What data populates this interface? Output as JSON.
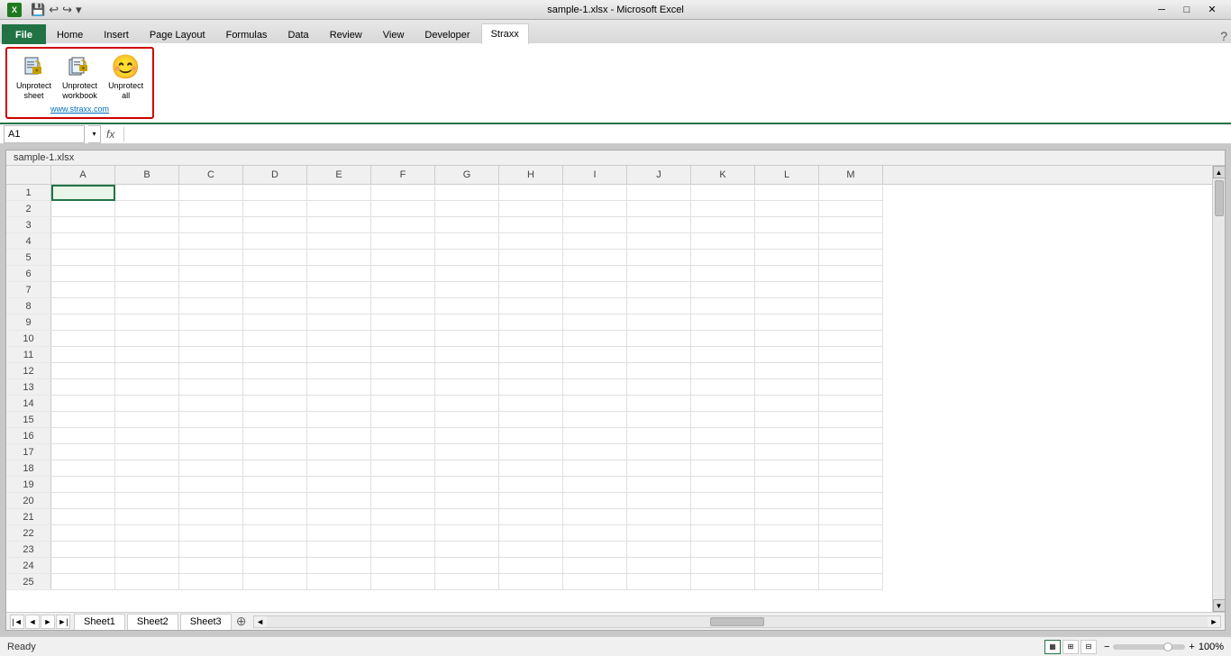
{
  "titlebar": {
    "title": "sample-1.xlsx  -  Microsoft Excel",
    "quicksave": "💾",
    "undo": "↩",
    "redo": "↪",
    "customize": "▾"
  },
  "ribbon": {
    "tabs": [
      "File",
      "Home",
      "Insert",
      "Page Layout",
      "Formulas",
      "Data",
      "Review",
      "View",
      "Developer",
      "Straxx"
    ],
    "active_tab": "Straxx",
    "groups": {
      "straxx": {
        "buttons": [
          {
            "label": "Unprotect\nsheet",
            "icon": "unlock-sheet"
          },
          {
            "label": "Unprotect\nworkbook",
            "icon": "unlock-workbook"
          },
          {
            "label": "Unprotect\nall",
            "icon": "smiley"
          }
        ],
        "website": "www.straxx.com"
      }
    }
  },
  "formula_bar": {
    "name_box": "A1",
    "fx": "fx"
  },
  "spreadsheet": {
    "title": "sample-1.xlsx",
    "columns": [
      "A",
      "B",
      "C",
      "D",
      "E",
      "F",
      "G",
      "H",
      "I",
      "J",
      "K",
      "L",
      "M"
    ],
    "rows": [
      1,
      2,
      3,
      4,
      5,
      6,
      7,
      8,
      9,
      10,
      11,
      12,
      13,
      14,
      15,
      16,
      17,
      18,
      19,
      20,
      21,
      22,
      23,
      24,
      25
    ]
  },
  "sheet_tabs": [
    "Sheet1",
    "Sheet2",
    "Sheet3"
  ],
  "active_sheet": "Sheet1",
  "status": {
    "ready": "Ready",
    "zoom": "100%"
  }
}
